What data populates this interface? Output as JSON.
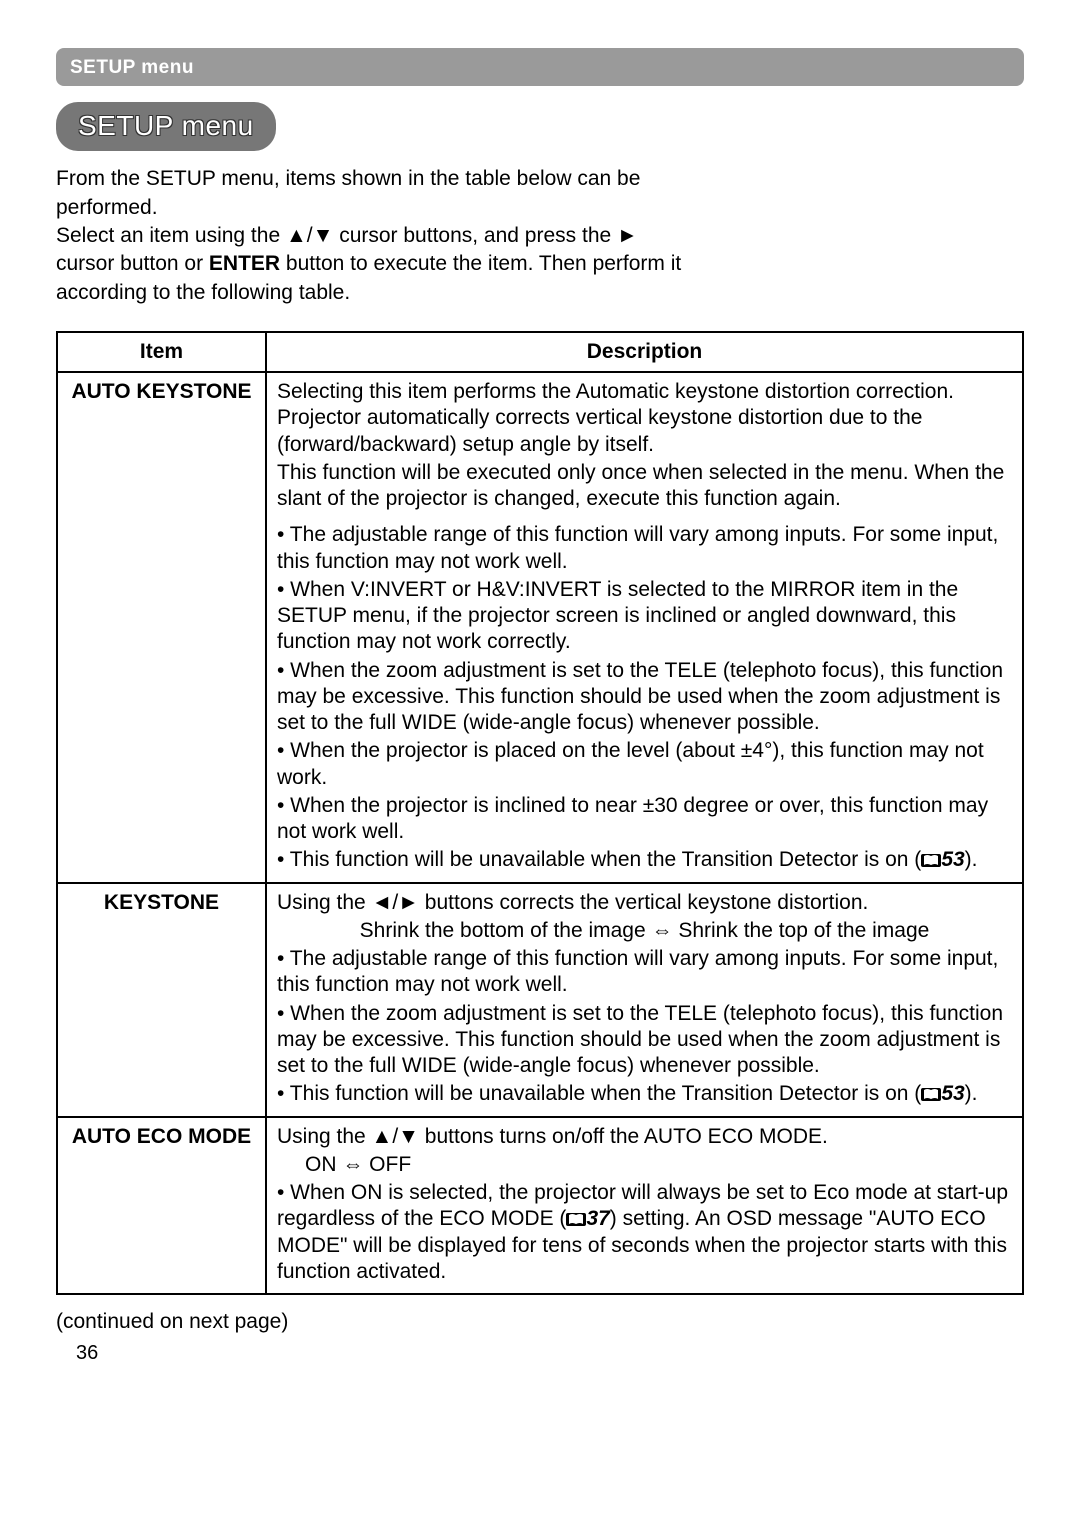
{
  "header": {
    "bar_label": "SETUP menu",
    "title": "SETUP menu"
  },
  "intro": {
    "p1": "From the SETUP menu, items shown in the table below can be performed.",
    "p2a": "Select an item using the ▲/▼ cursor buttons, and press the ► cursor button or ",
    "p2_enter": "ENTER",
    "p2b": " button to execute the item. Then perform it according to the following table."
  },
  "table": {
    "headers": {
      "item": "Item",
      "description": "Description"
    },
    "rows": [
      {
        "item": "AUTO KEYSTONE",
        "desc": {
          "p1": "Selecting this item performs the Automatic keystone distortion correction. Projector automatically corrects vertical keystone distortion due to the (forward/backward) setup angle by itself.",
          "p2": "This function will be executed only once when selected in the menu. When the slant of the projector is changed, execute this function again.",
          "b1": "• The adjustable range of this function will vary among inputs. For some input, this function may not work well.",
          "b2": "• When V:INVERT or H&V:INVERT is selected to the MIRROR item in the SETUP menu, if the projector screen is inclined or angled downward, this function may not work correctly.",
          "b3": "• When the zoom adjustment is set to the TELE (telephoto focus), this function may be excessive. This function should be used when the zoom adjustment is set to the full WIDE (wide-angle focus) whenever possible.",
          "b4": "• When the projector is placed on the level (about ±4°), this function may not work.",
          "b5": "• When the projector is inclined to near ±30 degree or over, this function may not work well.",
          "b6a": "• This function will be unavailable when the Transition Detector is on (",
          "b6_ref": "53",
          "b6b": ")."
        }
      },
      {
        "item": "KEYSTONE",
        "desc": {
          "p1": "Using the ◄/► buttons corrects the vertical keystone distortion.",
          "p2": "Shrink the bottom of the image ⇔ Shrink the top of the image",
          "b1": "• The adjustable range of this function will vary among inputs. For some input, this function may not work well.",
          "b2": "• When the zoom adjustment is set to the TELE (telephoto focus), this function may be excessive. This function should be used when the zoom adjustment is set to the full WIDE (wide-angle focus) whenever possible.",
          "b3a": "• This function will be unavailable when the Transition Detector is on (",
          "b3_ref": "53",
          "b3b": ")."
        }
      },
      {
        "item": "AUTO ECO MODE",
        "desc": {
          "p1": "Using the ▲/▼ buttons turns on/off the AUTO ECO MODE.",
          "p2": "ON ⇔ OFF",
          "b1a": "• When ON is selected, the projector will always be set to Eco mode at start-up regardless of the ECO MODE (",
          "b1_ref": "37",
          "b1b": ") setting. An OSD message \"AUTO ECO MODE\" will be displayed for tens of seconds when the projector starts with this function activated."
        }
      }
    ]
  },
  "footer": {
    "continued": "(continued on next page)",
    "page": "36"
  }
}
